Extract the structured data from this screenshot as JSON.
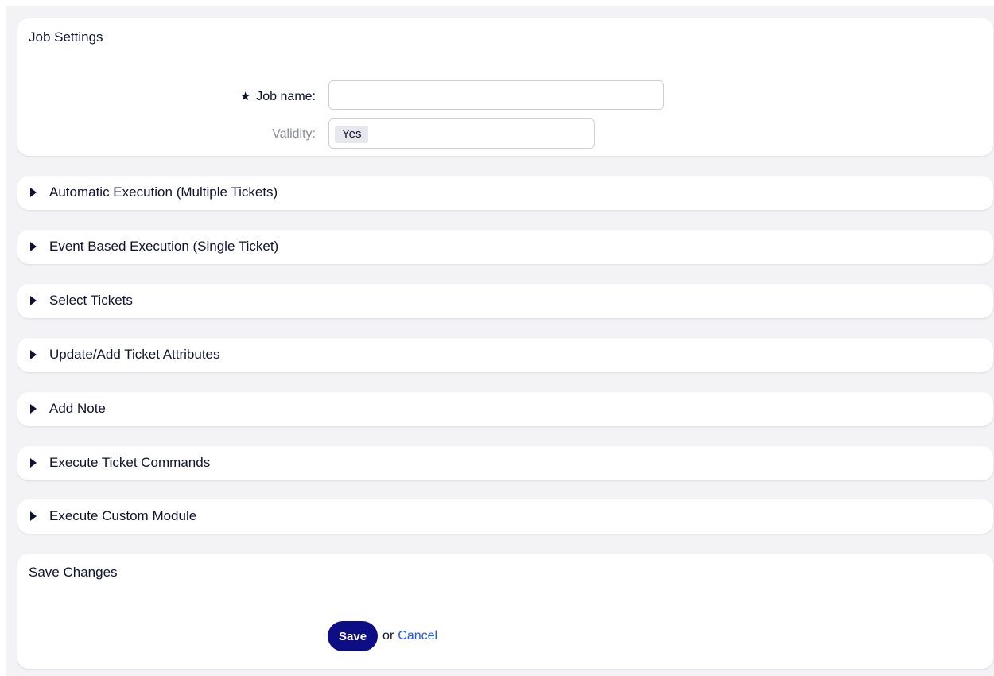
{
  "job_settings": {
    "title": "Job Settings",
    "job_name_star": "★",
    "job_name_label": "Job name:",
    "job_name_value": "",
    "job_name_placeholder": "",
    "validity_label": "Validity:",
    "validity_value": "Yes"
  },
  "sections": [
    {
      "label": "Automatic Execution (Multiple Tickets)",
      "expanded": false
    },
    {
      "label": "Event Based Execution (Single Ticket)",
      "expanded": false
    },
    {
      "label": "Select Tickets",
      "expanded": false
    },
    {
      "label": "Update/Add Ticket Attributes",
      "expanded": false
    },
    {
      "label": "Add Note",
      "expanded": false
    },
    {
      "label": "Execute Ticket Commands",
      "expanded": false
    },
    {
      "label": "Execute Custom Module",
      "expanded": false
    }
  ],
  "save_changes": {
    "title": "Save Changes",
    "save_label": "Save",
    "or_text": "or",
    "cancel_label": "Cancel"
  },
  "colors": {
    "accent": "#0d0d86",
    "link": "#1a56ff",
    "text": "#0f1330",
    "muted_text": "#8a8c95",
    "page_background": "#f3f3f6",
    "card_background": "#ffffff"
  },
  "icons": {
    "required": "star-icon",
    "section_toggle": "caret-right-icon"
  }
}
